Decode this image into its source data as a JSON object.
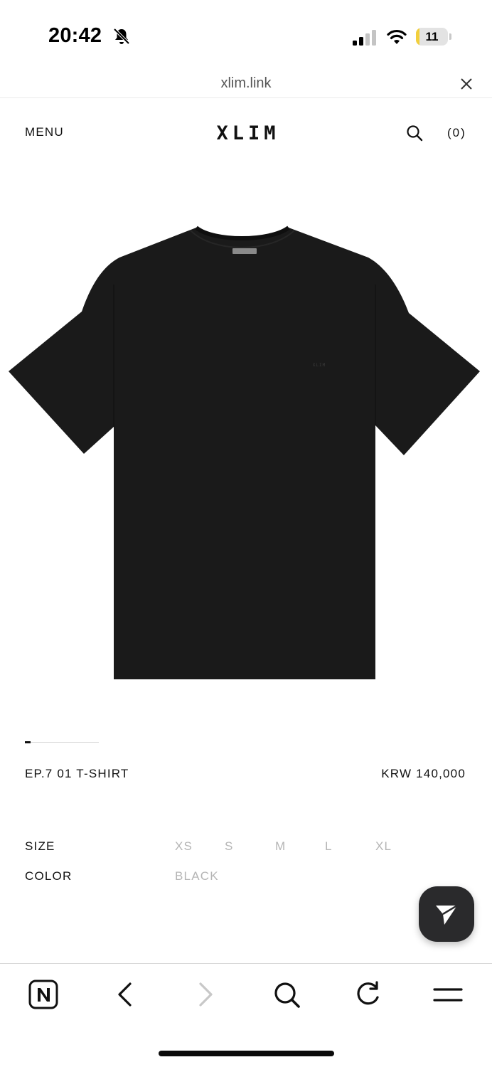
{
  "status_bar": {
    "time": "20:42",
    "battery_level": "11",
    "battery_fraction": 0.11,
    "icons": [
      "bell-slash-icon",
      "signal-icon",
      "wifi-icon",
      "battery-icon"
    ]
  },
  "browser": {
    "url": "xlim.link",
    "close_icon": "close-icon"
  },
  "header": {
    "menu_label": "MENU",
    "logo": "XLIM",
    "search_icon": "search-icon",
    "cart_count": "(0)"
  },
  "product": {
    "image_icon": "black-t-shirt-image",
    "garment_logo_text": "XLIM",
    "slide_position": 1,
    "name": "EP.7 01 T-SHIRT",
    "price": "KRW 140,000",
    "size_label": "SIZE",
    "sizes": [
      "XS",
      "S",
      "M",
      "L",
      "XL"
    ],
    "color_label": "COLOR",
    "color_value": "BLACK"
  },
  "fab": {
    "icon": "send-icon"
  },
  "toolbar": {
    "icons": [
      "naver-n-icon",
      "back-chevron-icon",
      "forward-chevron-icon",
      "search-icon",
      "refresh-icon",
      "menu-icon"
    ]
  },
  "colors": {
    "text": "#111111",
    "muted": "#b5b5b5",
    "battery_fill": "#f2cf3c",
    "garment": "#1a1a1a",
    "fab_bg": "#2a2a2c"
  }
}
